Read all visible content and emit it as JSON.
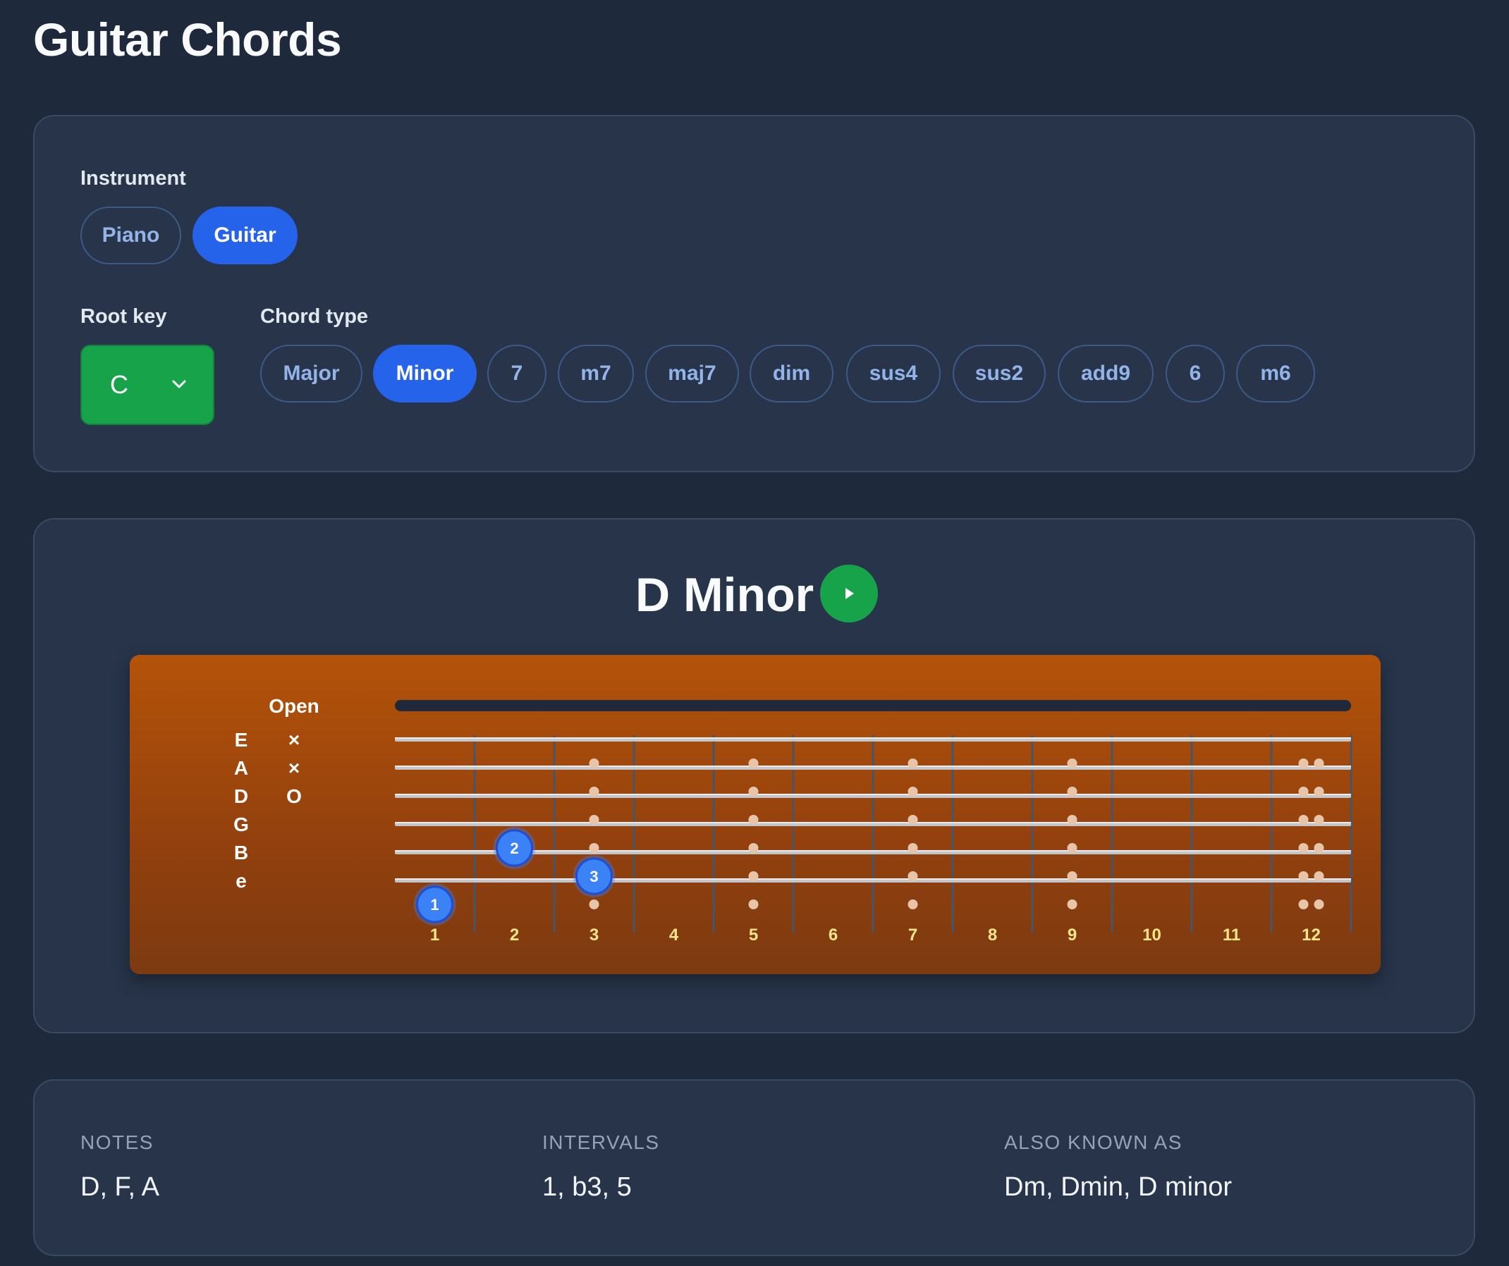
{
  "page": {
    "title": "Guitar Chords"
  },
  "controls": {
    "instrument_label": "Instrument",
    "instruments": [
      {
        "label": "Piano",
        "active": false
      },
      {
        "label": "Guitar",
        "active": true
      }
    ],
    "root_label": "Root key",
    "root_value": "C",
    "chord_type_label": "Chord type",
    "chord_types": [
      {
        "label": "Major",
        "active": false
      },
      {
        "label": "Minor",
        "active": true
      },
      {
        "label": "7",
        "active": false
      },
      {
        "label": "m7",
        "active": false
      },
      {
        "label": "maj7",
        "active": false
      },
      {
        "label": "dim",
        "active": false
      },
      {
        "label": "sus4",
        "active": false
      },
      {
        "label": "sus2",
        "active": false
      },
      {
        "label": "add9",
        "active": false
      },
      {
        "label": "6",
        "active": false
      },
      {
        "label": "m6",
        "active": false
      }
    ]
  },
  "diagram": {
    "chord_name": "D Minor",
    "play_icon": "play-icon",
    "open_label": "Open",
    "strings": [
      "E",
      "A",
      "D",
      "G",
      "B",
      "e"
    ],
    "open_markers": [
      "×",
      "×",
      "O",
      "",
      "",
      ""
    ],
    "frets": [
      "1",
      "2",
      "3",
      "4",
      "5",
      "6",
      "7",
      "8",
      "9",
      "10",
      "11",
      "12"
    ],
    "fingers": [
      {
        "finger": "1",
        "string": 7,
        "fret": 1
      },
      {
        "finger": "2",
        "string": 5,
        "fret": 2
      },
      {
        "finger": "3",
        "string": 6,
        "fret": 3
      }
    ],
    "colors": {
      "finger": "#3b82f6",
      "fret_number": "#fde68a",
      "inlay": "#e8c4a8"
    }
  },
  "info": {
    "notes_label": "NOTES",
    "notes_value": "D, F, A",
    "intervals_label": "INTERVALS",
    "intervals_value": "1, b3, 5",
    "aka_label": "ALSO KNOWN AS",
    "aka_value": "Dm, Dmin, D minor"
  }
}
